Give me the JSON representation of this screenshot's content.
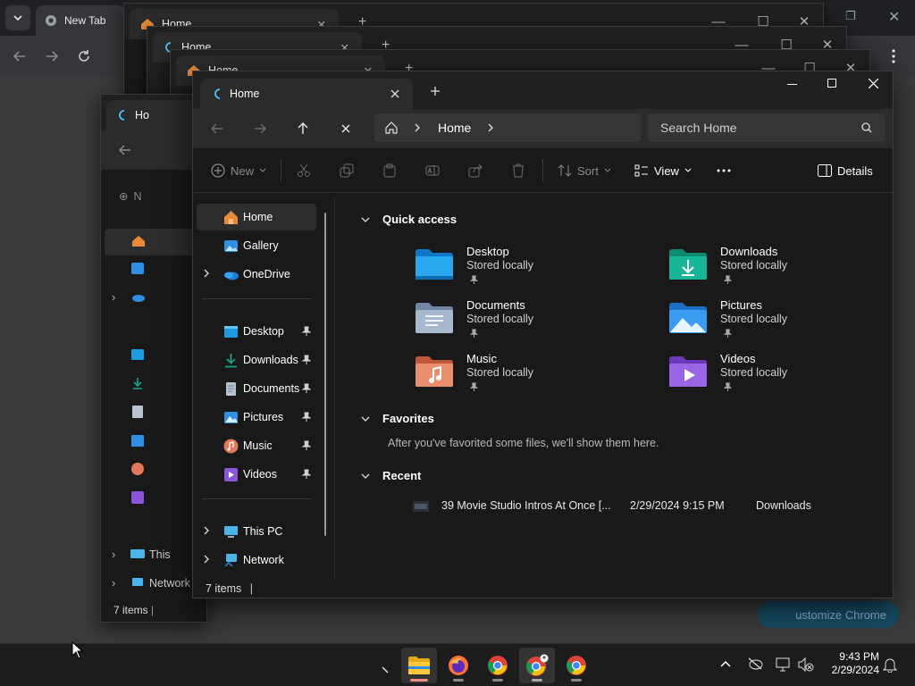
{
  "chrome": {
    "tab_title": "New Tab",
    "customize_label": "ustomize Chrome"
  },
  "background_windows": [
    {
      "tab_title": "Home"
    },
    {
      "tab_title": "Home"
    },
    {
      "tab_title": "Home"
    },
    {
      "tab_title": "Ho",
      "status": "7 items",
      "side_labels": [
        "N",
        "This",
        "Network"
      ]
    }
  ],
  "background_status_fragments": [
    "7 i",
    "7 i"
  ],
  "explorer": {
    "tab_title": "Home",
    "breadcrumb": [
      "Home"
    ],
    "search_placeholder": "Search Home",
    "toolbar": {
      "new_label": "New",
      "sort_label": "Sort",
      "view_label": "View",
      "details_label": "Details"
    },
    "nav_pane": {
      "top": [
        {
          "label": "Home",
          "icon": "home-icon",
          "selected": true
        },
        {
          "label": "Gallery",
          "icon": "gallery-icon"
        },
        {
          "label": "OneDrive",
          "icon": "onedrive-icon",
          "expandable": true
        }
      ],
      "pinned": [
        {
          "label": "Desktop",
          "icon": "desktop-folder-icon"
        },
        {
          "label": "Downloads",
          "icon": "downloads-folder-icon"
        },
        {
          "label": "Documents",
          "icon": "documents-folder-icon"
        },
        {
          "label": "Pictures",
          "icon": "pictures-folder-icon"
        },
        {
          "label": "Music",
          "icon": "music-folder-icon"
        },
        {
          "label": "Videos",
          "icon": "videos-folder-icon"
        }
      ],
      "bottom": [
        {
          "label": "This PC",
          "icon": "this-pc-icon",
          "expandable": true
        },
        {
          "label": "Network",
          "icon": "network-icon",
          "expandable": true
        }
      ]
    },
    "sections": {
      "quick_access": "Quick access",
      "favorites": "Favorites",
      "recent": "Recent"
    },
    "quick_access": [
      {
        "name": "Desktop",
        "sub": "Stored locally",
        "icon": "desktop-folder-icon",
        "color": "#1e9be0"
      },
      {
        "name": "Downloads",
        "sub": "Stored locally",
        "icon": "downloads-folder-icon",
        "color": "#15a58b"
      },
      {
        "name": "Documents",
        "sub": "Stored locally",
        "icon": "documents-folder-icon",
        "color": "#8aa2c2"
      },
      {
        "name": "Pictures",
        "sub": "Stored locally",
        "icon": "pictures-folder-icon",
        "color": "#2f8de4"
      },
      {
        "name": "Music",
        "sub": "Stored locally",
        "icon": "music-folder-icon",
        "color": "#e07a5a"
      },
      {
        "name": "Videos",
        "sub": "Stored locally",
        "icon": "videos-folder-icon",
        "color": "#8a55d6"
      }
    ],
    "favorites_message": "After you've favorited some files, we'll show them here.",
    "recent": [
      {
        "name": "39 Movie Studio Intros At Once [...",
        "date": "2/29/2024 9:15 PM",
        "location": "Downloads"
      }
    ],
    "status": "7 items"
  },
  "taskbar": {
    "apps": [
      "file-explorer-icon",
      "firefox-icon",
      "chrome-icon",
      "chrome-profile-icon",
      "chrome-icon"
    ],
    "time": "9:43 PM",
    "date": "2/29/2024"
  }
}
